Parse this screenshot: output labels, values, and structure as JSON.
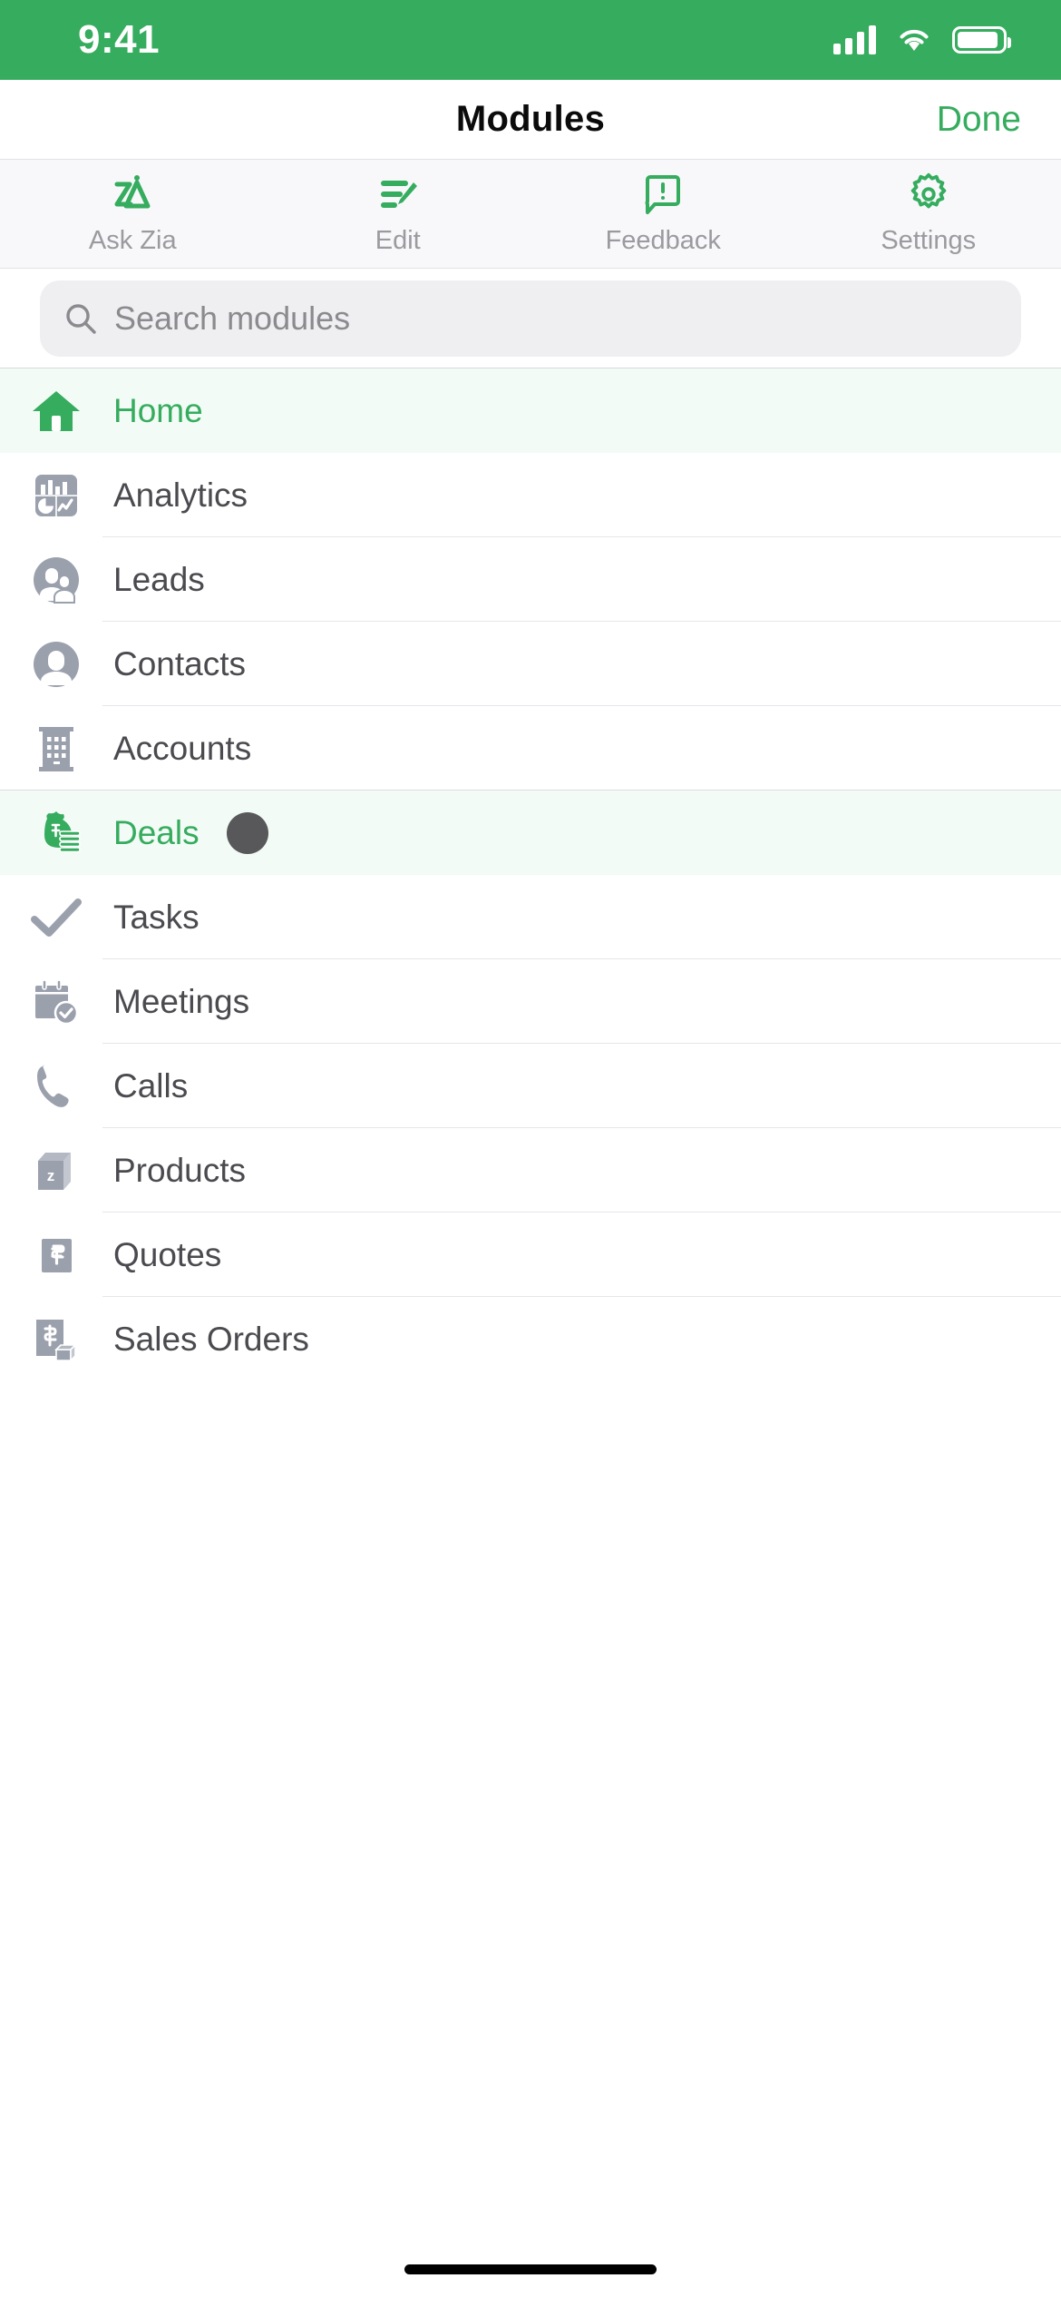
{
  "status_bar": {
    "time": "9:41",
    "background": "#35ac5e",
    "icons": [
      "cellular-signal-icon",
      "wifi-icon",
      "battery-icon"
    ]
  },
  "navbar": {
    "title": "Modules",
    "done_label": "Done",
    "accent": "#35ac5e"
  },
  "toolbar": {
    "items": [
      {
        "label": "Ask Zia",
        "icon": "ask-zia-icon"
      },
      {
        "label": "Edit",
        "icon": "edit-list-icon"
      },
      {
        "label": "Feedback",
        "icon": "feedback-bubble-icon"
      },
      {
        "label": "Settings",
        "icon": "gear-icon"
      }
    ]
  },
  "search": {
    "placeholder": "Search modules",
    "value": "",
    "icon": "search-icon"
  },
  "modules": [
    {
      "label": "Home",
      "icon": "home-icon",
      "selected": true,
      "pressed": false
    },
    {
      "label": "Analytics",
      "icon": "analytics-icon",
      "selected": false,
      "pressed": false
    },
    {
      "label": "Leads",
      "icon": "leads-icon",
      "selected": false,
      "pressed": false
    },
    {
      "label": "Contacts",
      "icon": "contacts-icon",
      "selected": false,
      "pressed": false
    },
    {
      "label": "Accounts",
      "icon": "accounts-icon",
      "selected": false,
      "pressed": false
    },
    {
      "label": "Deals",
      "icon": "deals-icon",
      "selected": true,
      "pressed": true
    },
    {
      "label": "Tasks",
      "icon": "tasks-check-icon",
      "selected": false,
      "pressed": false
    },
    {
      "label": "Meetings",
      "icon": "meetings-icon",
      "selected": false,
      "pressed": false
    },
    {
      "label": "Calls",
      "icon": "calls-phone-icon",
      "selected": false,
      "pressed": false
    },
    {
      "label": "Products",
      "icon": "products-box-icon",
      "selected": false,
      "pressed": false
    },
    {
      "label": "Quotes",
      "icon": "quotes-icon",
      "selected": false,
      "pressed": false
    },
    {
      "label": "Sales Orders",
      "icon": "sales-orders-icon",
      "selected": false,
      "pressed": false
    }
  ],
  "colors": {
    "accent_green": "#35ac5e",
    "selected_row_bg": "#f3fbf6",
    "icon_gray": "#9ba0ad",
    "text_gray": "#4a4a4f",
    "touch_dot": "#58585a"
  },
  "home_indicator": {
    "visible": true
  }
}
